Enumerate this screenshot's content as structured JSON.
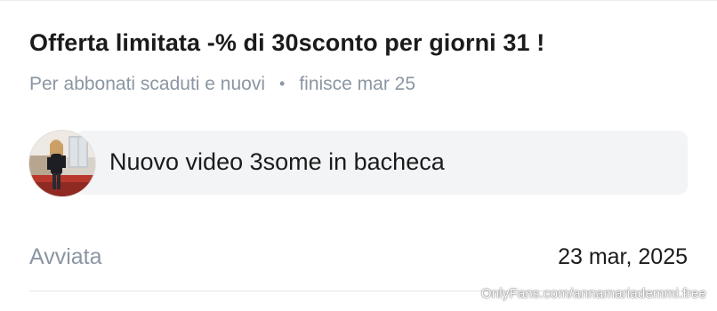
{
  "offer": {
    "title": "Offerta limitata -% di 30sconto per giorni 31 !",
    "audience": "Per abbonati scaduti e nuovi",
    "separator": "•",
    "ends": "finisce mar 25"
  },
  "message": {
    "avatar_icon": "creator-avatar-icon",
    "text": "Nuovo video 3some in bacheca"
  },
  "status": {
    "label": "Avviata",
    "date": "23 mar, 2025"
  },
  "watermark": "OnlyFans.com/annamariademmi.free",
  "colors": {
    "title": "#1b1b1b",
    "muted": "#8a96a3",
    "bubble": "#f2f4f6"
  }
}
